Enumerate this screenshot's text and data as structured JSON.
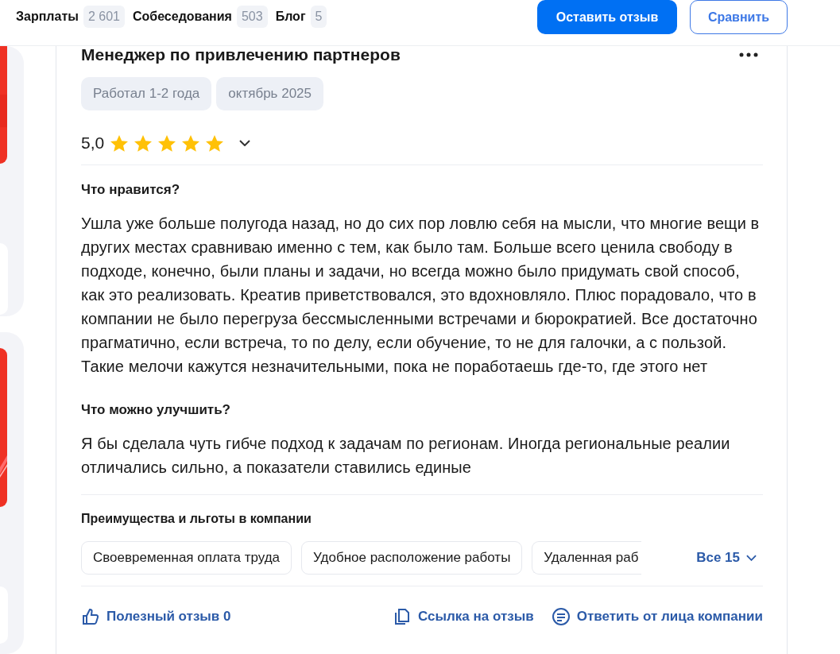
{
  "nav": [
    {
      "label": "Зарплаты",
      "count": "2 601"
    },
    {
      "label": "Собеседования",
      "count": "503"
    },
    {
      "label": "Блог",
      "count": "5"
    }
  ],
  "header_buttons": [
    {
      "label": "Оставить отзыв",
      "kind": "primary"
    },
    {
      "label": "Сравнить",
      "kind": "outline"
    }
  ],
  "review": {
    "title": "Менеджер по привлечению партнеров",
    "tags": [
      "Работал 1-2 года",
      "октябрь 2025"
    ],
    "rating": "5,0",
    "stars": 5,
    "sections": [
      {
        "heading": "Что нравится?",
        "text": "Ушла уже больше полугода назад, но до сих пор ловлю себя на мысли, что многие вещи в других местах сравниваю именно с тем, как было там. Больше всего ценила свободу в подходе, конечно, были планы и задачи, но всегда можно было придумать свой способ, как это реализовать. Креатив приветствовался, это вдохновляло. Плюс порадовало, что в компании не было перегруза бессмысленными встречами и бюрократией. Все достаточно прагматично, если встреча, то по делу, если обучение, то не для галочки, а с пользой. Такие мелочи кажутся незначительными, пока не поработаешь где-то, где этого нет"
      },
      {
        "heading": "Что можно улучшить?",
        "text": "Я бы сделала чуть гибче подход к задачам по регионам. Иногда региональные реалии отличались сильно, а показатели ставились единые"
      }
    ],
    "benefits": {
      "heading": "Преимущества и льготы в компании",
      "items": [
        "Своевременная оплата труда",
        "Удобное расположение работы",
        "Удаленная раб"
      ],
      "more": "Все 15"
    },
    "actions": [
      {
        "label": "Полезный отзыв 0",
        "kind": "like"
      },
      {
        "label": "Ссылка на отзыв",
        "kind": "copy"
      },
      {
        "label": "Ответить от лица компании",
        "kind": "reply"
      }
    ]
  }
}
